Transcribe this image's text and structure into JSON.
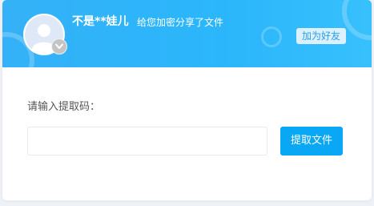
{
  "header": {
    "user_name": "不是**娃儿",
    "share_text": "给您加密分享了文件",
    "add_friend_label": "加为好友"
  },
  "form": {
    "prompt_label": "请输入提取码：",
    "code_value": "",
    "submit_label": "提取文件"
  },
  "icons": {
    "avatar": "default-user-avatar-icon",
    "vip": "vip-chevron-icon"
  },
  "colors": {
    "header_bg": "#2bb6fb",
    "button_bg": "#0aa7f5",
    "add_friend_bg": "#dcf1ff",
    "add_friend_text": "#2a9fe6",
    "page_bg": "#eef1f7"
  }
}
